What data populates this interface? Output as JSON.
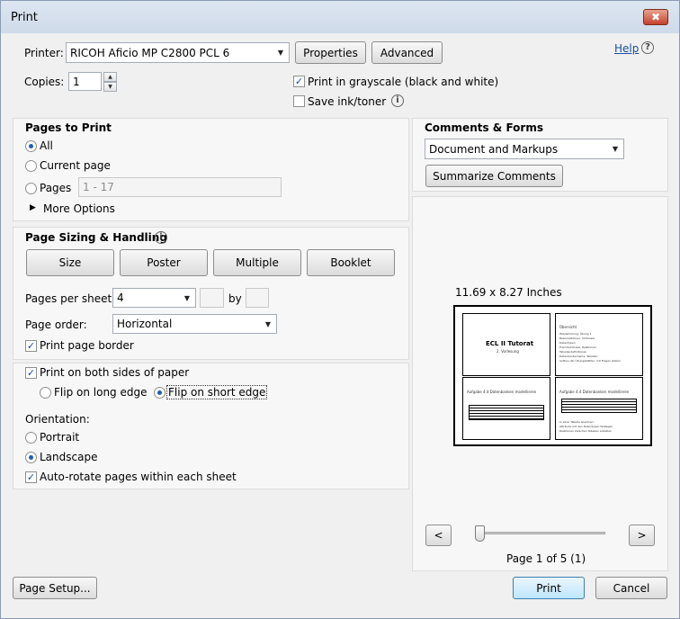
{
  "window": {
    "title": "Print",
    "close_glyph": "✖"
  },
  "help": {
    "label": "Help",
    "icon": "help-icon"
  },
  "printer": {
    "label": "Printer:",
    "value": "RICOH Aficio MP C2800 PCL 6",
    "properties_label": "Properties",
    "advanced_label": "Advanced"
  },
  "copies": {
    "label": "Copies:",
    "value": "1"
  },
  "options": {
    "grayscale_label": "Print in grayscale (black and white)",
    "grayscale_checked": true,
    "save_ink_label": "Save ink/toner",
    "save_ink_checked": false
  },
  "pages_to_print": {
    "title": "Pages to Print",
    "all_label": "All",
    "current_label": "Current page",
    "pages_label": "Pages",
    "pages_value": "1 - 17",
    "more_options_label": "More Options",
    "selected": "all"
  },
  "sizing": {
    "title": "Page Sizing & Handling",
    "tabs": [
      "Size",
      "Poster",
      "Multiple",
      "Booklet"
    ],
    "pages_per_sheet_label": "Pages per sheet:",
    "pages_per_sheet_value": "4",
    "by_label": "by",
    "page_order_label": "Page order:",
    "page_order_value": "Horizontal",
    "print_border_label": "Print page border",
    "print_border_checked": true
  },
  "duplex": {
    "both_sides_label": "Print on both sides of paper",
    "both_sides_checked": true,
    "long_edge_label": "Flip on long edge",
    "short_edge_label": "Flip on short edge",
    "selected": "short"
  },
  "orientation": {
    "label": "Orientation:",
    "portrait_label": "Portrait",
    "landscape_label": "Landscape",
    "selected": "landscape",
    "autorotate_label": "Auto-rotate pages within each sheet",
    "autorotate_checked": true
  },
  "comments": {
    "title": "Comments & Forms",
    "value": "Document and Markups",
    "summarize_label": "Summarize Comments"
  },
  "preview": {
    "size_label": "11.69 x 8.27 Inches",
    "page_1_title": "ECL II Tutorat",
    "page_1_subtitle": "2. Vorlesung",
    "page_2_lines": [
      "Übersicht",
      "Wiederholung: Übung 1",
      "Basisrelationen, Schlüssel",
      "Datentypen",
      "Fremdschlüssel, Relationen",
      "Tabellendefinitionen",
      "Datenbankschema, Tabellen",
      "Aufbau der Übungsblätter, mit Fragen stellen"
    ],
    "page_3_title": "Aufgabe 4.4 Datenbanken modellieren",
    "page_4_title": "Aufgabe 4.4 Datenbanken modellieren",
    "page_4_lines": [
      "In einer Tabelle speichern",
      "Attribute mit den Datentypen festlegen",
      "Relationen zwischen Tabellen erstellen"
    ],
    "prev_glyph": "<",
    "next_glyph": ">",
    "page_indicator": "Page 1 of 5 (1)",
    "slider_fraction": 0
  },
  "footer": {
    "page_setup_label": "Page Setup...",
    "print_label": "Print",
    "cancel_label": "Cancel"
  }
}
